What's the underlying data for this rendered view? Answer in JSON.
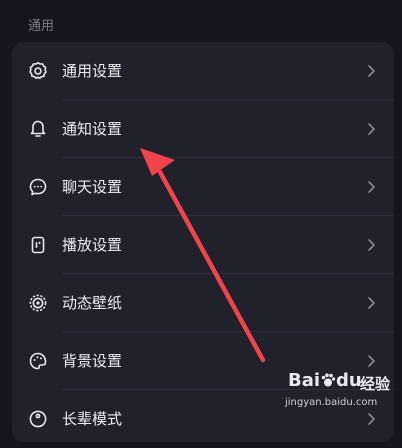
{
  "section": {
    "title": "通用"
  },
  "settings": {
    "items": [
      {
        "label": "通用设置",
        "icon": "gear-icon"
      },
      {
        "label": "通知设置",
        "icon": "bell-icon"
      },
      {
        "label": "聊天设置",
        "icon": "chat-bubble-icon"
      },
      {
        "label": "播放设置",
        "icon": "play-device-icon"
      },
      {
        "label": "动态壁纸",
        "icon": "live-wallpaper-icon"
      },
      {
        "label": "背景设置",
        "icon": "palette-icon"
      },
      {
        "label": "长辈模式",
        "icon": "elder-mode-icon"
      }
    ]
  },
  "annotation": {
    "color": "#f0444a",
    "target": "通知设置"
  },
  "watermark": {
    "brand_pre": "Bai",
    "brand_post": "du",
    "brand_suffix": "经验",
    "url": "jingyan.baidu.com"
  },
  "colors": {
    "background": "#15151d",
    "card": "#20212b",
    "text": "#ececf2",
    "muted": "#7d7d88"
  }
}
